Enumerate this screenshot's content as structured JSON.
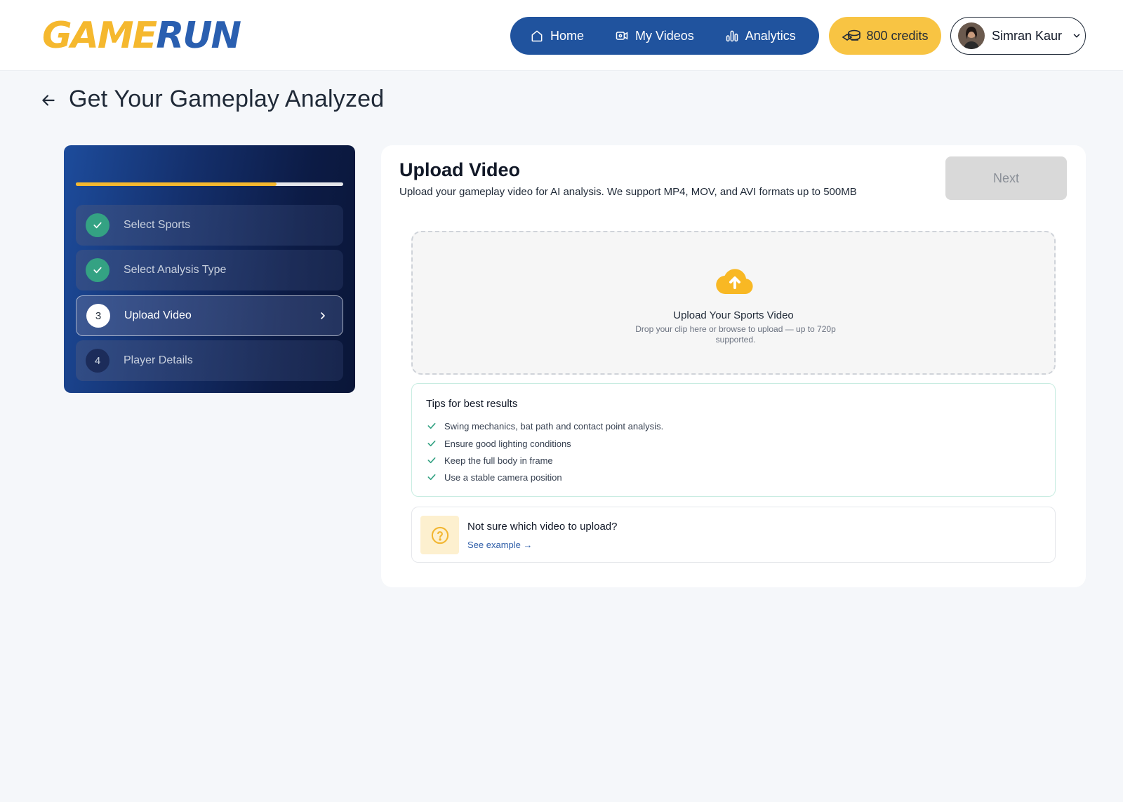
{
  "brand": {
    "logo_text": "GAMERUN",
    "logo_colors": {
      "game": "#f5b82e",
      "run": "#2a5fb0"
    }
  },
  "nav": {
    "items": [
      {
        "label": "Home",
        "icon": "home-icon"
      },
      {
        "label": "My Videos",
        "icon": "video-icon"
      },
      {
        "label": "Analytics",
        "icon": "bar-chart-icon"
      }
    ]
  },
  "credits": {
    "label": "800 credits",
    "icon": "coins-icon"
  },
  "user": {
    "name": "Simran Kaur",
    "icon": "chevron-down-icon"
  },
  "page": {
    "title": "Get Your Gameplay Analyzed",
    "back_icon": "arrow-left-icon"
  },
  "stepper": {
    "progress": 0.75,
    "steps": [
      {
        "number": "1",
        "label": "Select Sports",
        "status": "completed"
      },
      {
        "number": "2",
        "label": "Select Analysis Type",
        "status": "completed"
      },
      {
        "number": "3",
        "label": "Upload Video",
        "status": "active"
      },
      {
        "number": "4",
        "label": "Player Details",
        "status": "pending"
      }
    ]
  },
  "upload": {
    "title": "Upload Video",
    "subtitle": "Upload your gameplay video for AI analysis. We support MP4, MOV, and AVI formats up to 500MB",
    "next_label": "Next",
    "dropzone": {
      "title": "Upload Your Sports Video",
      "description": "Drop your clip here or browse to upload — up to 720p supported.",
      "icon": "cloud-upload-icon"
    }
  },
  "tips": {
    "title": "Tips for best results",
    "items": [
      "Swing mechanics, bat path and contact point analysis.",
      "Ensure good lighting conditions",
      "Keep the full body in frame",
      "Use a stable camera position"
    ]
  },
  "help": {
    "title": "Not sure which video to upload?",
    "link": "See example →",
    "icon": "question-circle-icon"
  },
  "colors": {
    "primary_blue": "#20539e",
    "accent_yellow": "#f8c443",
    "success_green": "#34a283",
    "background": "#f5f7fa"
  }
}
